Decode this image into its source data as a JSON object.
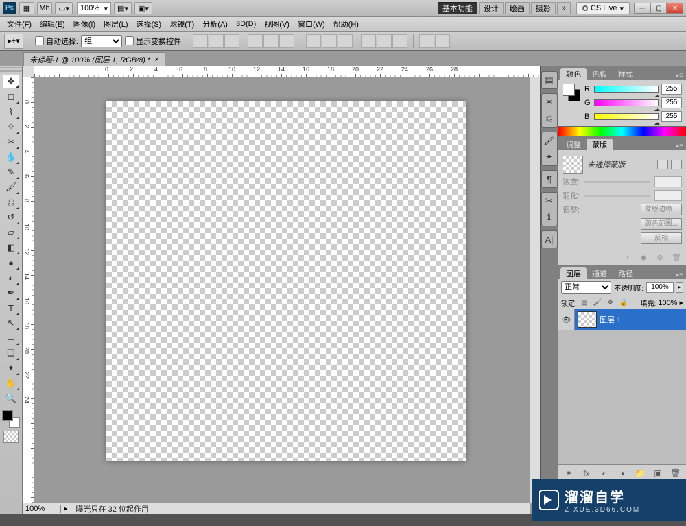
{
  "titlebar": {
    "zoom": "100%",
    "workspaces": [
      "基本功能",
      "设计",
      "绘画",
      "摄影",
      "»"
    ],
    "active_workspace": 0,
    "cslive": "CS Live"
  },
  "menu": [
    "文件(F)",
    "编辑(E)",
    "图像(I)",
    "图层(L)",
    "选择(S)",
    "滤镜(T)",
    "分析(A)",
    "3D(D)",
    "视图(V)",
    "窗口(W)",
    "帮助(H)"
  ],
  "options": {
    "auto_select": "自动选择:",
    "group": "组",
    "show_transform": "显示变换控件"
  },
  "document": {
    "tab": "未标题-1 @ 100% (图层 1, RGB/8) *"
  },
  "status": {
    "zoom": "100%",
    "message": "曝光只在 32 位起作用"
  },
  "ruler_h": [
    "0",
    "2",
    "4",
    "6",
    "8",
    "10",
    "12",
    "14",
    "16",
    "18",
    "20",
    "22",
    "24",
    "26",
    "28"
  ],
  "ruler_v": [
    "0",
    "2",
    "4",
    "6",
    "8",
    "10",
    "12",
    "14",
    "16",
    "18",
    "20",
    "22",
    "24"
  ],
  "panels": {
    "color": {
      "tabs": [
        "颜色",
        "色板",
        "样式"
      ],
      "channels": [
        {
          "label": "R",
          "value": "255"
        },
        {
          "label": "G",
          "value": "255"
        },
        {
          "label": "B",
          "value": "255"
        }
      ]
    },
    "mask": {
      "tabs": [
        "调整",
        "蒙版"
      ],
      "none_selected": "未选择蒙版",
      "density": "浓度:",
      "feather": "羽化:",
      "adjust": "调整:",
      "btn_edge": "蒙版边缘...",
      "btn_range": "颜色范围...",
      "btn_invert": "反相"
    },
    "layers": {
      "tabs": [
        "图层",
        "通道",
        "路径"
      ],
      "blend": "正常",
      "opacity_label": "不透明度:",
      "opacity": "100%",
      "lock_label": "锁定:",
      "fill_label": "填充:",
      "fill": "100%",
      "layer_name": "图层 1"
    }
  },
  "watermark": {
    "title": "溜溜自学",
    "url": "ZIXUE.3D66.COM"
  }
}
